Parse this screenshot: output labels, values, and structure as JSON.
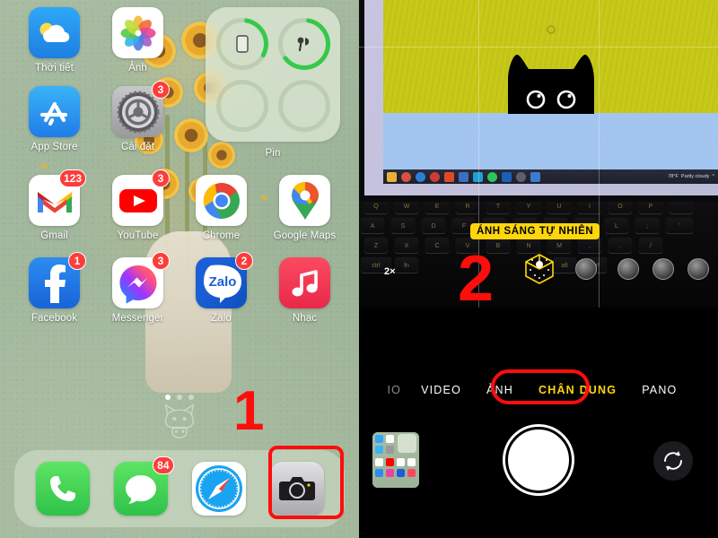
{
  "home": {
    "rows": [
      [
        {
          "name": "Thời tiết",
          "icon": "weather-icon",
          "badge": null
        },
        {
          "name": "Ảnh",
          "icon": "photos-icon",
          "badge": null
        }
      ],
      [
        {
          "name": "App Store",
          "icon": "appstore-icon",
          "badge": null
        },
        {
          "name": "Cài đặt",
          "icon": "settings-icon",
          "badge": "3"
        }
      ],
      [
        {
          "name": "Gmail",
          "icon": "gmail-icon",
          "badge": "123"
        },
        {
          "name": "YouTube",
          "icon": "youtube-icon",
          "badge": "3"
        },
        {
          "name": "Chrome",
          "icon": "chrome-icon",
          "badge": null
        },
        {
          "name": "Google Maps",
          "icon": "google-maps-icon",
          "badge": null
        }
      ],
      [
        {
          "name": "Facebook",
          "icon": "facebook-icon",
          "badge": "1"
        },
        {
          "name": "Messenger",
          "icon": "messenger-icon",
          "badge": "3"
        },
        {
          "name": "Zalo",
          "icon": "zalo-icon",
          "badge": "2"
        },
        {
          "name": "Nhạc",
          "icon": "music-icon",
          "badge": null
        }
      ]
    ],
    "widget": {
      "label": "Pin",
      "rings": [
        {
          "device": "iphone-ring",
          "percent": 30
        },
        {
          "device": "airpods-ring",
          "percent": 62
        },
        {
          "device": "empty-ring-1",
          "percent": 0
        },
        {
          "device": "empty-ring-2",
          "percent": 0
        }
      ]
    },
    "page_dots": {
      "count": 3,
      "active_index": 0
    },
    "dock": [
      {
        "name": "Điện thoại",
        "icon": "phone-icon",
        "badge": null
      },
      {
        "name": "Tin nhắn",
        "icon": "messages-icon",
        "badge": "84"
      },
      {
        "name": "Safari",
        "icon": "safari-icon",
        "badge": null
      },
      {
        "name": "Camera",
        "icon": "camera-icon",
        "badge": null,
        "highlighted": true
      }
    ],
    "annotation": {
      "step": "1"
    }
  },
  "camera": {
    "viewfinder": {
      "subject": "black-cat-wallpaper-on-laptop",
      "taskbar": {
        "weather_temp": "78°F",
        "weather_text": "Partly cloudy"
      },
      "grid_enabled": true,
      "colors": {
        "wall_top": "#c9c916",
        "wall_bottom": "#9ec8f2",
        "cat": "#000000"
      }
    },
    "lighting_badge": "ÁNH SÁNG TỰ NHIÊN",
    "zoom_level": "2×",
    "lighting_icon": "portrait-lighting-cube-icon",
    "modes": [
      {
        "label": "IO",
        "active": false,
        "cut_off": true
      },
      {
        "label": "VIDEO",
        "active": false
      },
      {
        "label": "ẢNH",
        "active": false
      },
      {
        "label": "CHÂN DUNG",
        "active": true,
        "highlighted": true
      },
      {
        "label": "PANO",
        "active": false
      }
    ],
    "controls": {
      "thumbnail": "last-photo-thumbnail",
      "shutter": "shutter-button",
      "flip": "flip-camera-icon"
    },
    "annotation": {
      "step": "2"
    }
  },
  "colors": {
    "annotation_red": "#ff0d0d",
    "accent_yellow": "#ffd60a",
    "badge_red": "#fc3d39"
  }
}
